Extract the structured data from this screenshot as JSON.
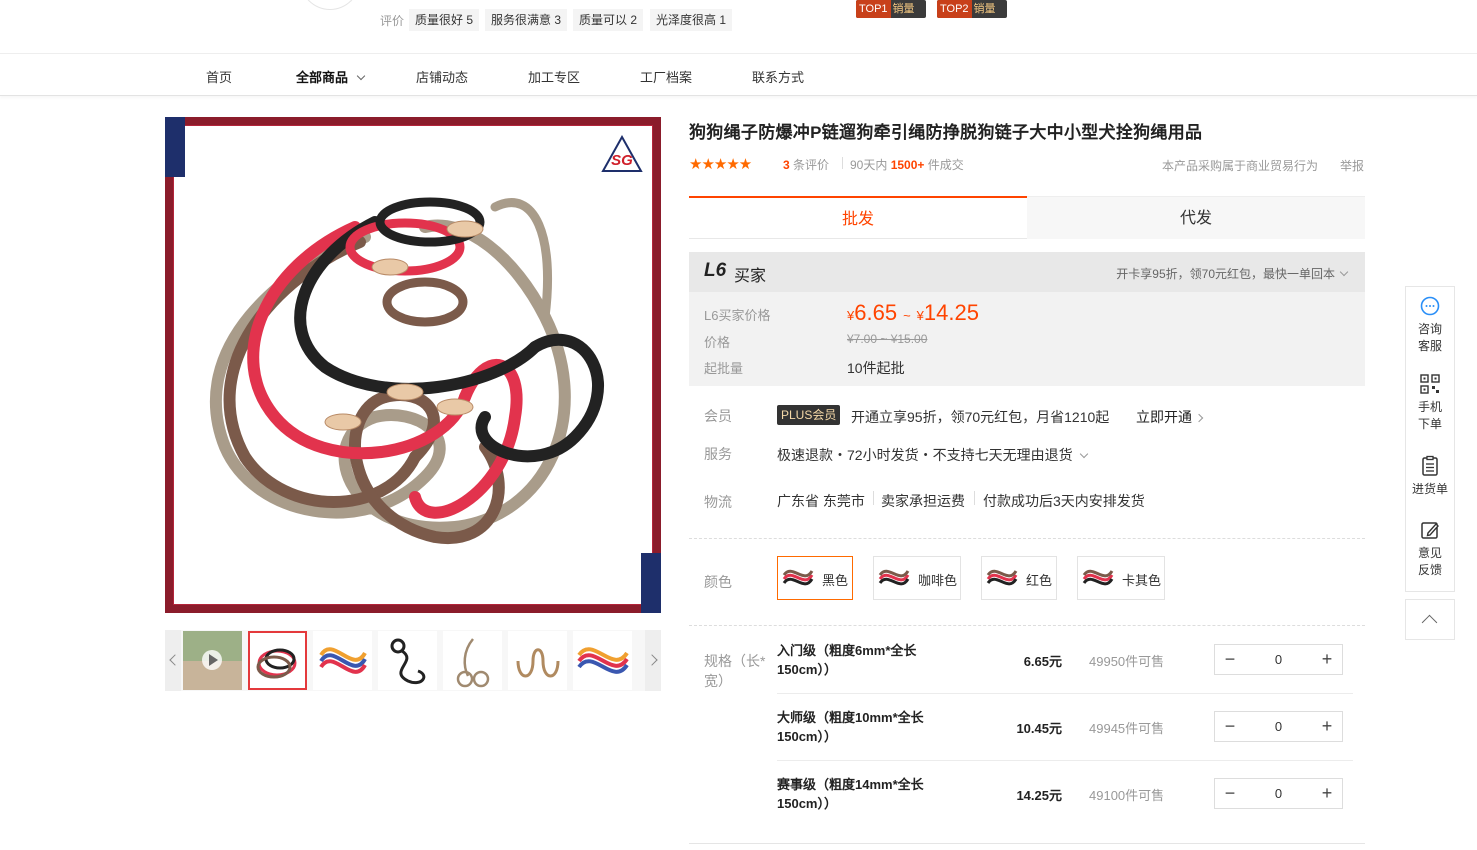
{
  "top": {
    "eval_label": "评价",
    "eval_tags": [
      "质量很好 5",
      "服务很满意 3",
      "质量可以 2",
      "光泽度很高 1"
    ],
    "rank_badges": [
      {
        "rank": "TOP1",
        "text": "销量"
      },
      {
        "rank": "TOP2",
        "text": "销量"
      }
    ]
  },
  "nav": {
    "items": [
      "首页",
      "全部商品",
      "店铺动态",
      "加工专区",
      "工厂档案",
      "联系方式"
    ],
    "active": "全部商品"
  },
  "product": {
    "title": "狗狗绳子防爆冲P链遛狗牵引绳防挣脱狗链子大中小型犬拴狗绳用品",
    "stars": "★★★★★",
    "review_count": "3",
    "review_suffix": "条评价",
    "sales_prefix": "90天内",
    "sales_count": "1500+",
    "sales_suffix": "件成交",
    "trade_note": "本产品采购属于商业贸易行为",
    "report": "举报",
    "logo_text": "SG"
  },
  "tabs": [
    "批发",
    "代发"
  ],
  "price_box": {
    "l6_logo": "L6",
    "l6_text": "买家",
    "promo": "开卡享95折，领70元红包，最快一单回本",
    "labels": {
      "l6_price": "L6买家价格",
      "price": "价格",
      "min_order": "起批量"
    },
    "currency": "¥",
    "price_low": "6.65",
    "price_high": "14.25",
    "price_sep": "~",
    "orig_price": "¥7.00 ~ ¥15.00",
    "min_order": "10件起批"
  },
  "member": {
    "label": "会员",
    "badge": "PLUS会员",
    "text": "开通立享95折，领70元红包，月省1210起",
    "link": "立即开通"
  },
  "service": {
    "label": "服务",
    "text": "极速退款・72小时发货・不支持七天无理由退货"
  },
  "logistics": {
    "label": "物流",
    "items": [
      "广东省 东莞市",
      "卖家承担运费",
      "付款成功后3天内安排发货"
    ]
  },
  "colors": {
    "label": "颜色",
    "options": [
      "黑色",
      "咖啡色",
      "红色",
      "卡其色"
    ],
    "selected": "黑色"
  },
  "specs": {
    "label": "规格（长*宽）",
    "rows": [
      {
        "name": "入门级（粗度6mm*全长150cm））",
        "price": "6.65元",
        "stock": "49950件可售",
        "qty": "0"
      },
      {
        "name": "大师级（粗度10mm*全长150cm））",
        "price": "10.45元",
        "stock": "49945件可售",
        "qty": "0"
      },
      {
        "name": "赛事级（粗度14mm*全长150cm））",
        "price": "14.25元",
        "stock": "49100件可售",
        "qty": "0"
      }
    ],
    "minus": "−",
    "plus": "+"
  },
  "sidebar": {
    "items": [
      {
        "line1": "咨询",
        "line2": "客服",
        "icon": "chat-icon"
      },
      {
        "line1": "手机",
        "line2": "下单",
        "icon": "qrcode-icon"
      },
      {
        "line1": "进货单",
        "line2": "",
        "icon": "clipboard-icon"
      },
      {
        "line1": "意见",
        "line2": "反馈",
        "icon": "edit-icon"
      }
    ]
  },
  "brand_colors": {
    "accent": "#ff4400",
    "frame": "#8b1c2b",
    "frame_corner": "#1e2f6b"
  }
}
